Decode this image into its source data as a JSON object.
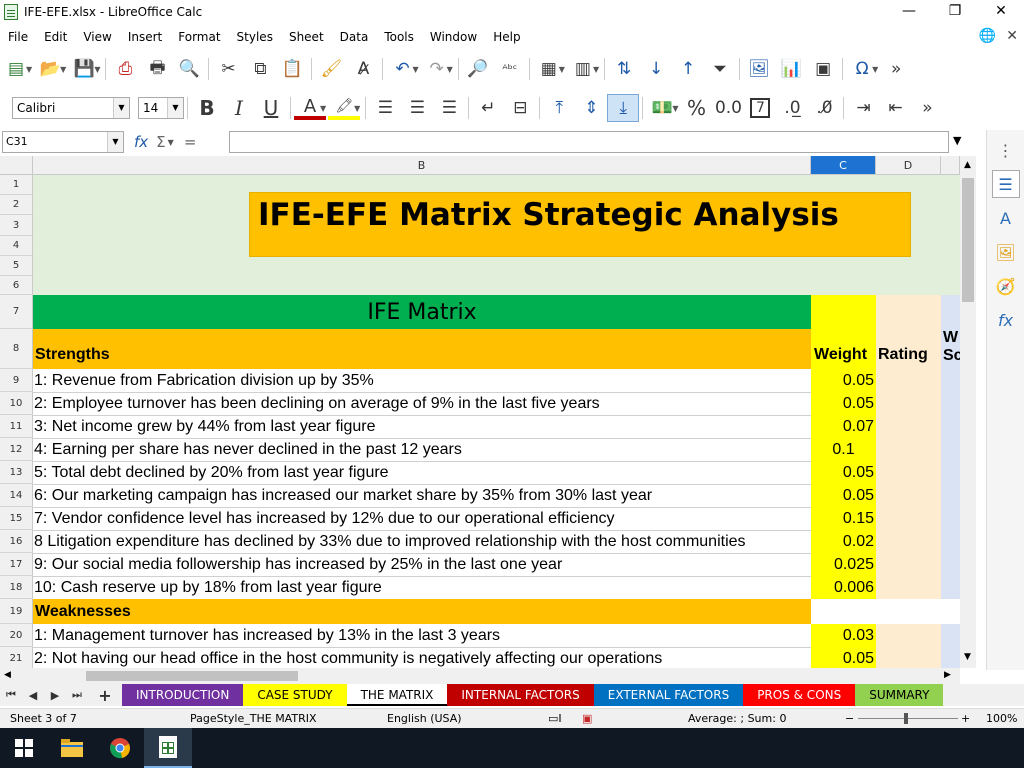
{
  "window": {
    "title": "IFE-EFE.xlsx - LibreOffice Calc",
    "controls": [
      "minimize",
      "restore",
      "close"
    ]
  },
  "menu": [
    "File",
    "Edit",
    "View",
    "Insert",
    "Format",
    "Styles",
    "Sheet",
    "Data",
    "Tools",
    "Window",
    "Help"
  ],
  "formatting": {
    "font_name": "Calibri",
    "font_size": "14"
  },
  "formula_bar": {
    "name_box": "C31",
    "formula": ""
  },
  "columns": {
    "b": "B",
    "c": "C",
    "d": "D"
  },
  "rows": [
    "1",
    "2",
    "3",
    "4",
    "5",
    "6",
    "7",
    "8",
    "9",
    "10",
    "11",
    "12",
    "13",
    "14",
    "15",
    "16",
    "17",
    "18",
    "19",
    "20",
    "21"
  ],
  "sheet": {
    "title": "IFE-EFE Matrix Strategic Analysis",
    "section_title": "IFE Matrix",
    "strengths_label": "Strengths",
    "weight_header": "Weight",
    "rating_header": "Rating",
    "weighted_score_header_partial": "W\nSc",
    "weaknesses_label": "Weaknesses",
    "strengths": [
      {
        "text": "1: Revenue from Fabrication division up by 35%",
        "weight": "0.05"
      },
      {
        "text": "2: Employee turnover has been declining on average of 9% in the last five years",
        "weight": "0.05"
      },
      {
        "text": "3: Net income grew by 44% from last year figure",
        "weight": "0.07"
      },
      {
        "text": "4: Earning per share has never declined in the past 12 years",
        "weight": "0.1"
      },
      {
        "text": "5: Total debt declined  by 20% from last year figure",
        "weight": "0.05"
      },
      {
        "text": "6: Our marketing campaign has increased our market share by 35% from 30% last year",
        "weight": "0.05"
      },
      {
        "text": "7: Vendor confidence level has increased by 12% due to our operational efficiency",
        "weight": "0.15"
      },
      {
        "text": "8 Litigation expenditure has declined by 33% due to improved relationship with the host communities",
        "weight": "0.02"
      },
      {
        "text": "9: Our social media followership has increased by 25% in the last one year",
        "weight": "0.025"
      },
      {
        "text": "10: Cash reserve up by 18% from last year figure",
        "weight": "0.006"
      }
    ],
    "weaknesses": [
      {
        "text": "1: Management turnover has increased by 13%  in the last 3 years",
        "weight": "0.03"
      },
      {
        "text": "2: Not having our head office in the host community is negatively affecting our operations",
        "weight": "0.05"
      }
    ]
  },
  "tabs": [
    {
      "label": "INTRODUCTION",
      "color": "#7030a0"
    },
    {
      "label": "CASE STUDY",
      "color": "#ffff00"
    },
    {
      "label": "THE MATRIX",
      "color": "#ffffff"
    },
    {
      "label": "INTERNAL FACTORS",
      "color": "#c00000"
    },
    {
      "label": "EXTERNAL FACTORS",
      "color": "#0070c0"
    },
    {
      "label": "PROS & CONS",
      "color": "#ff0000"
    },
    {
      "label": "SUMMARY",
      "color": "#92d050"
    }
  ],
  "status": {
    "sheet": "Sheet 3 of 7",
    "page_style": "PageStyle_THE MATRIX",
    "language": "English (USA)",
    "summary": "Average: ; Sum: 0",
    "zoom": "100%"
  },
  "colors": {
    "title_fill": "#ffc000",
    "header_band": "#e2efda",
    "ife_fill": "#00b050",
    "orange": "#ffc000",
    "weight_fill": "#ffff00",
    "rating_fill": "#fdeccf",
    "score_fill": "#dae3f3"
  }
}
